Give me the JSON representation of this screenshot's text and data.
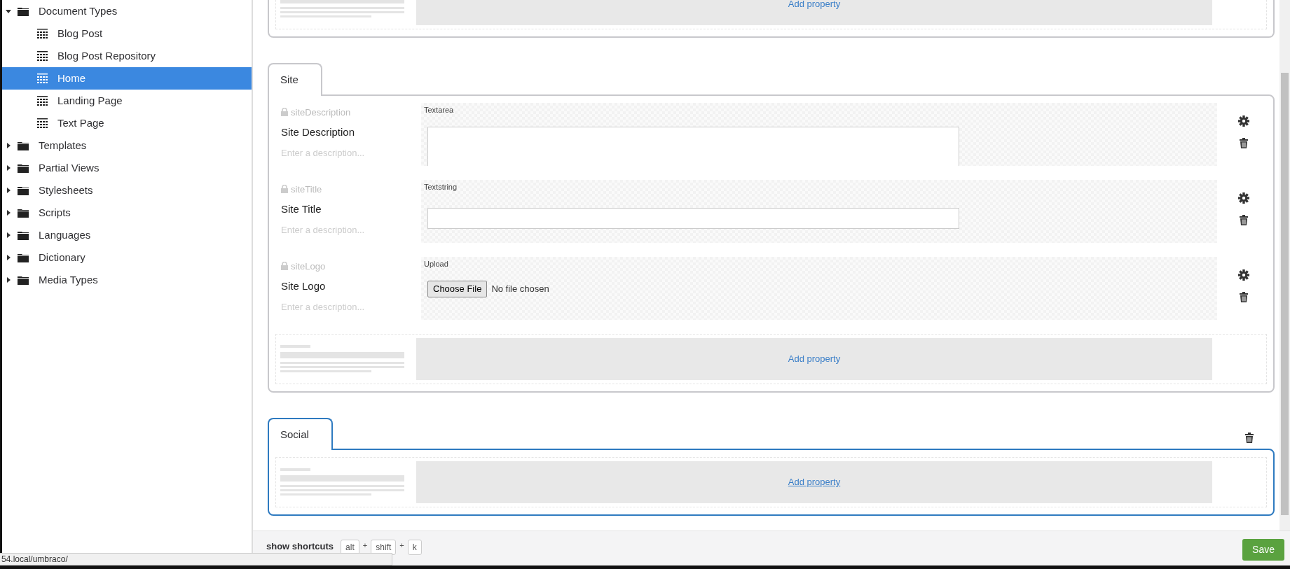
{
  "sidebar": {
    "items": [
      {
        "label": "Document Types",
        "kind": "folder",
        "expanded": true,
        "selected": false,
        "children": [
          {
            "label": "Blog Post",
            "kind": "doctype",
            "selected": false
          },
          {
            "label": "Blog Post Repository",
            "kind": "doctype",
            "selected": false
          },
          {
            "label": "Home",
            "kind": "doctype",
            "selected": true
          },
          {
            "label": "Landing Page",
            "kind": "doctype",
            "selected": false
          },
          {
            "label": "Text Page",
            "kind": "doctype",
            "selected": false
          }
        ]
      },
      {
        "label": "Templates",
        "kind": "folder",
        "expanded": false,
        "selected": false
      },
      {
        "label": "Partial Views",
        "kind": "folder",
        "expanded": false,
        "selected": false
      },
      {
        "label": "Stylesheets",
        "kind": "folder",
        "expanded": false,
        "selected": false
      },
      {
        "label": "Scripts",
        "kind": "folder",
        "expanded": false,
        "selected": false
      },
      {
        "label": "Languages",
        "kind": "folder",
        "expanded": false,
        "selected": false
      },
      {
        "label": "Dictionary",
        "kind": "folder",
        "expanded": false,
        "selected": false
      },
      {
        "label": "Media Types",
        "kind": "folder",
        "expanded": false,
        "selected": false
      }
    ]
  },
  "groups": [
    {
      "selected": false,
      "add_property": "Add property"
    },
    {
      "tab": "Site",
      "selected": false,
      "properties": [
        {
          "alias": "siteDescription",
          "name": "Site Description",
          "description_placeholder": "Enter a description...",
          "editor": "Textarea",
          "kind": "textarea"
        },
        {
          "alias": "siteTitle",
          "name": "Site Title",
          "description_placeholder": "Enter a description...",
          "editor": "Textstring",
          "kind": "textstring"
        },
        {
          "alias": "siteLogo",
          "name": "Site Logo",
          "description_placeholder": "Enter a description...",
          "editor": "Upload",
          "kind": "upload",
          "button": "Choose File",
          "file_status": "No file chosen"
        }
      ],
      "add_property": "Add property"
    },
    {
      "tab": "Social",
      "selected": true,
      "add_property": "Add property"
    }
  ],
  "footer": {
    "shortcuts_label": "show shortcuts",
    "keys": [
      "alt",
      "+",
      "shift",
      "+",
      "k"
    ],
    "save": "Save"
  },
  "status_url": "54.local/umbraco/"
}
